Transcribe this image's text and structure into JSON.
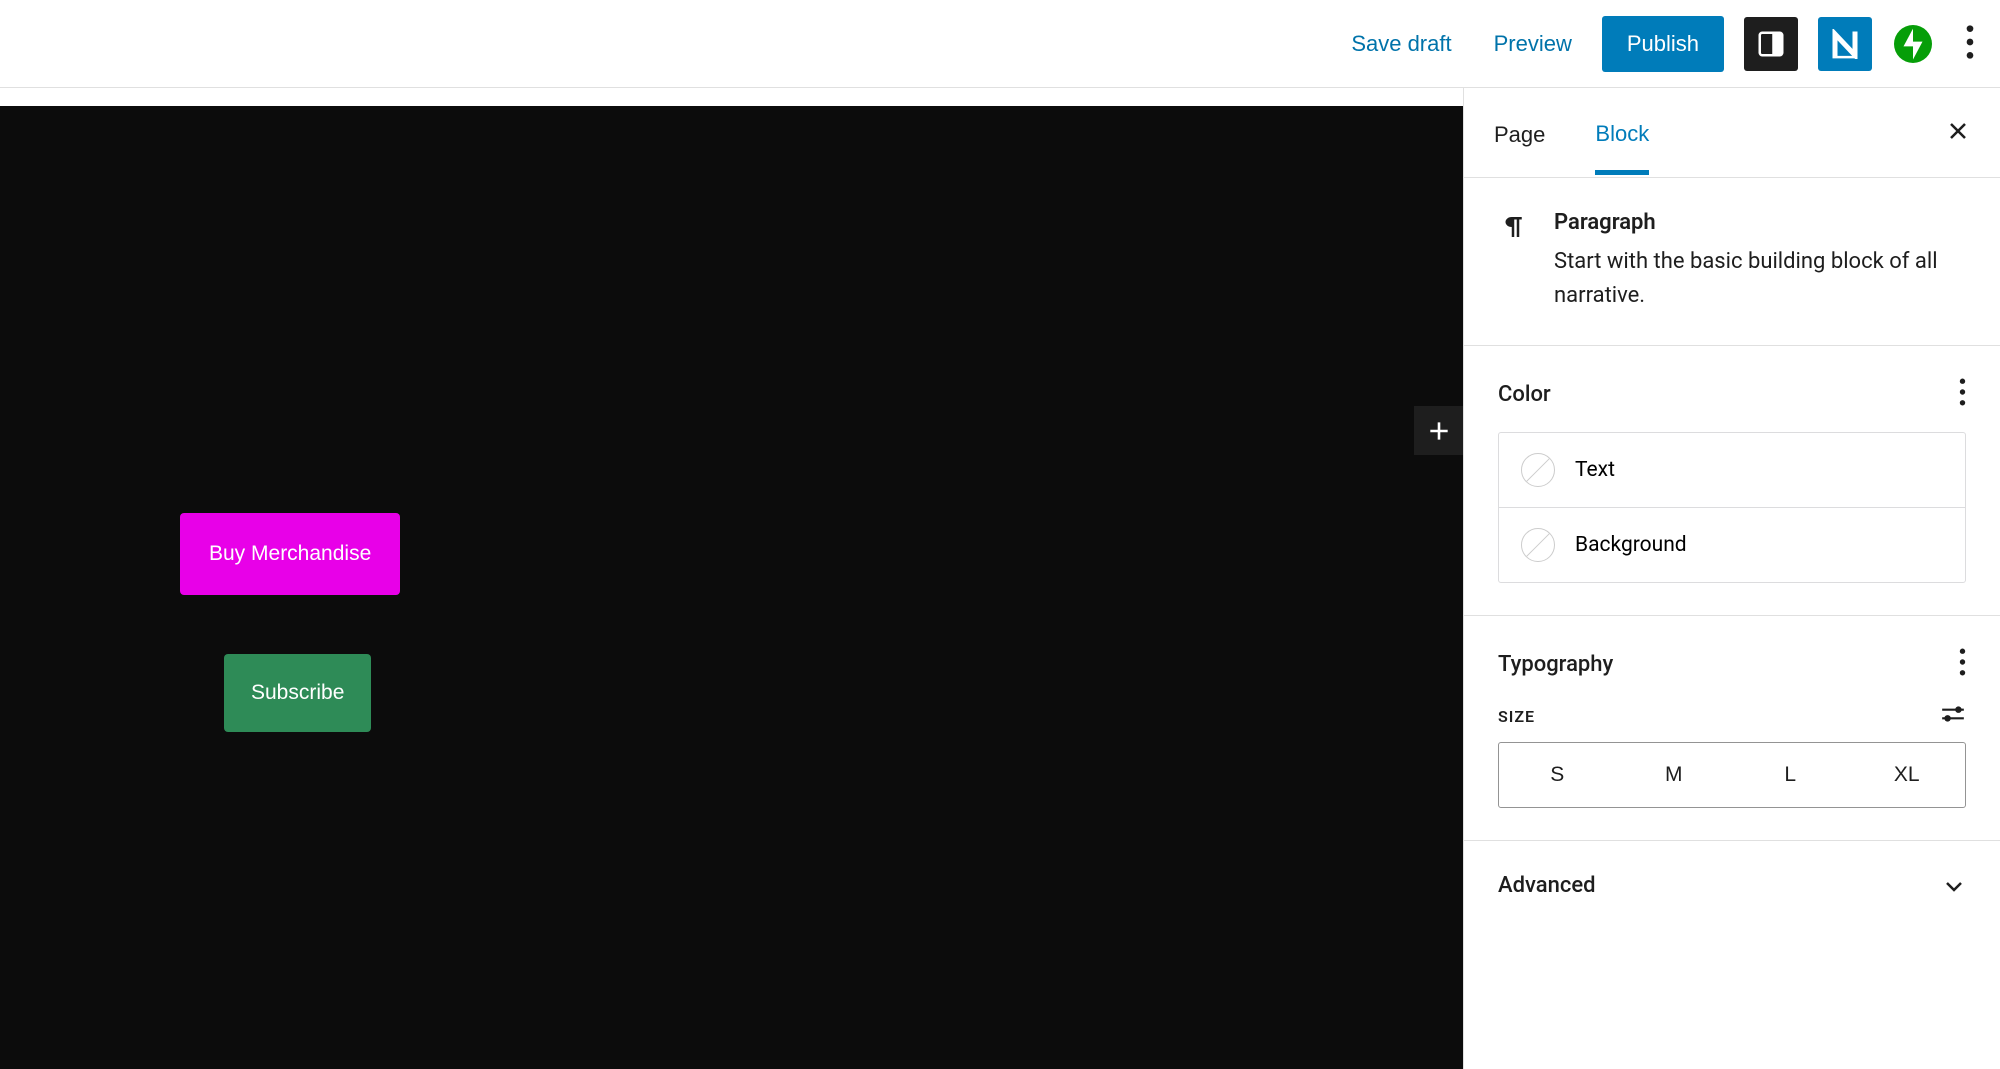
{
  "header": {
    "save_draft": "Save draft",
    "preview": "Preview",
    "publish": "Publish",
    "logo_letter": "N"
  },
  "canvas": {
    "button_pink": "Buy Merchandise",
    "button_green": "Subscribe"
  },
  "sidebar": {
    "tab_page": "Page",
    "tab_block": "Block",
    "block": {
      "title": "Paragraph",
      "description": "Start with the basic building block of all narrative."
    },
    "color": {
      "heading": "Color",
      "text_label": "Text",
      "background_label": "Background"
    },
    "typography": {
      "heading": "Typography",
      "size_label": "SIZE",
      "sizes": [
        "S",
        "M",
        "L",
        "XL"
      ]
    },
    "advanced": {
      "heading": "Advanced"
    }
  }
}
